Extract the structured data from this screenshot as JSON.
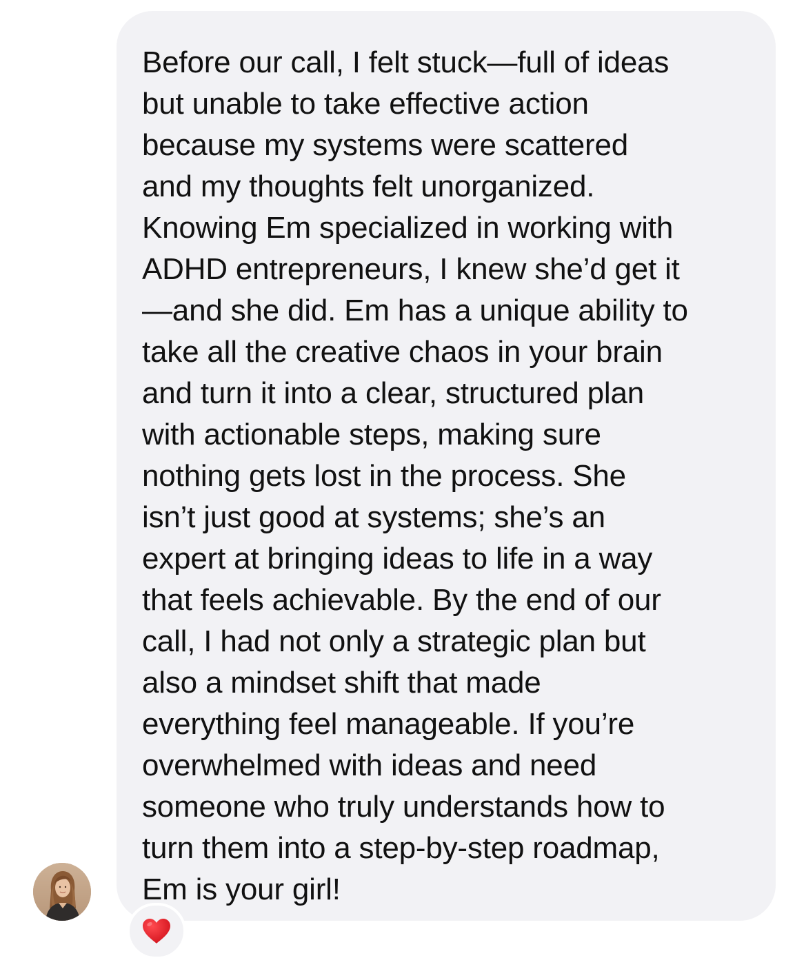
{
  "message": {
    "lines": [
      "Before our call, I felt stuck—full of ideas",
      "but unable to take effective action",
      "because my systems were scattered",
      "and my thoughts felt unorganized.",
      "Knowing Em specialized in working with",
      "ADHD entrepreneurs, I knew she’d get it",
      "—and she did. Em has a unique ability to",
      "take all the creative chaos in your brain",
      "and turn it into a clear, structured plan",
      "with actionable steps, making sure",
      "nothing gets lost in the process. She",
      "isn’t just good at systems; she’s an",
      "expert at bringing ideas to life in a way",
      "that feels achievable. By the end of our",
      "call, I had not only a strategic plan but",
      "also a mindset shift that made",
      "everything feel manageable. If you’re",
      "overwhelmed with ideas and need",
      "someone who truly understands how to",
      "turn them into a step-by-step roadmap,",
      "Em is your girl!"
    ],
    "bubble_color": "#f2f2f5",
    "text_color": "#111111"
  },
  "sender": {
    "avatar_icon": "profile-photo"
  },
  "reaction": {
    "icon": "red-heart-icon",
    "color": "#e0141e"
  }
}
